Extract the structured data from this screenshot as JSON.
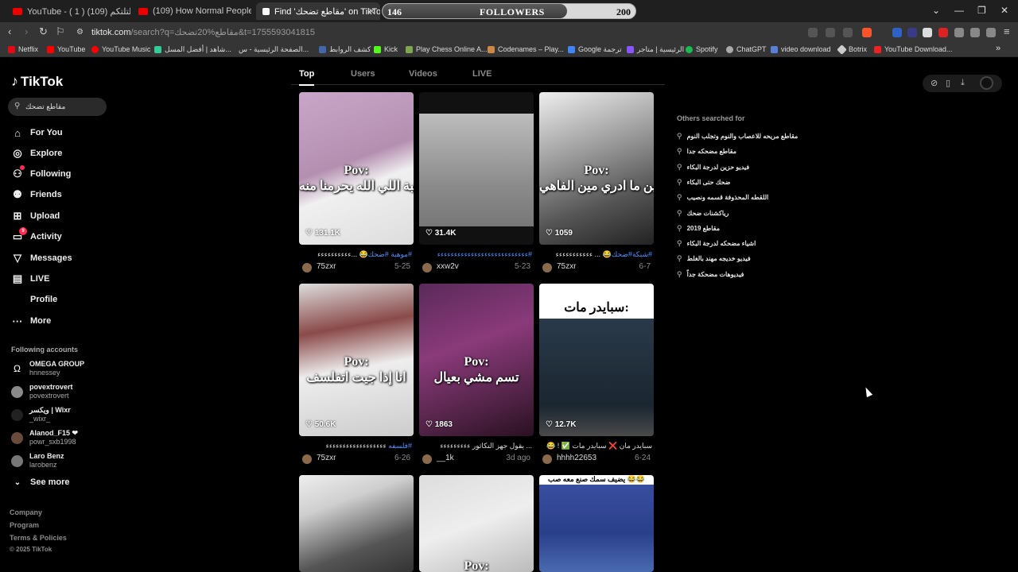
{
  "browser": {
    "tabs": [
      {
        "title": "YouTube - ( 1 ) اسلتلتكم (109)"
      },
      {
        "title": "(109) How Normal People Use C"
      },
      {
        "title": "Find 'مقاطع تضحك' on TikTok"
      }
    ],
    "followers_widget": {
      "current": "146",
      "label": "FOLLOWERS",
      "goal": "200",
      "progress": 0.73
    },
    "url_host": "tiktok.com",
    "url_rest": "/search?q=مقاطع%20تضحك&t=1755593041815",
    "bookmarks": [
      "Netflix",
      "YouTube",
      "YouTube Music",
      "شاهد | أفضل المسل...",
      "الصفحة الرئيسية - س...",
      "كشف الروابط",
      "Kick",
      "Play Chess Online A...",
      "Codenames – Play...",
      "Google ترجمة",
      "الرئيسية | متاجر",
      "Spotify",
      "ChatGPT",
      "video download",
      "Botrix",
      "YouTube Download..."
    ]
  },
  "sidebar": {
    "logo": "TikTok",
    "search_value": "مقاطع تضحك",
    "nav": [
      {
        "label": "For You",
        "icon": "home-icon"
      },
      {
        "label": "Explore",
        "icon": "compass-icon"
      },
      {
        "label": "Following",
        "icon": "following-icon"
      },
      {
        "label": "Friends",
        "icon": "friends-icon"
      },
      {
        "label": "Upload",
        "icon": "upload-icon"
      },
      {
        "label": "Activity",
        "icon": "activity-icon",
        "badge": "9"
      },
      {
        "label": "Messages",
        "icon": "messages-icon"
      },
      {
        "label": "LIVE",
        "icon": "live-icon"
      },
      {
        "label": "Profile",
        "icon": "profile-icon"
      },
      {
        "label": "More",
        "icon": "more-icon"
      }
    ],
    "following_title": "Following accounts",
    "accounts": [
      {
        "name": "OMEGA GROUP",
        "handle": "hnnessey"
      },
      {
        "name": "povextrovert",
        "handle": "povextrovert"
      },
      {
        "name": "ويكسر | Wixr",
        "handle": "_wixr_"
      },
      {
        "name": "Alanod_F15 ❤",
        "handle": "powr_sxb1998"
      },
      {
        "name": "Laro Benz",
        "handle": "larobenz"
      }
    ],
    "see_more": "See more",
    "footer": [
      "Company",
      "Program",
      "Terms & Policies",
      "© 2025 TikTok"
    ]
  },
  "search_tabs": [
    "Top",
    "Users",
    "Videos",
    "LIVE"
  ],
  "videos": [
    {
      "overlay": "Pov:\nوهبة اللي الله يحرمنا منه",
      "likes": "131.1K",
      "caption": "#موهبة #ضحك😂 ...ءءءءءءءءءء",
      "owner": "75zxr",
      "date": "5-25"
    },
    {
      "overlay": "",
      "likes": "31.4K",
      "caption": "#ءءءءءءءءءءءءءءءءءءءءءءءءءءء",
      "owner": "xxw2v",
      "date": "5-23"
    },
    {
      "overlay": "Pov:\nللحين ما ادري مين الفاهي",
      "likes": "1059",
      "caption": "#شبكة#ضحك😂 ... ءءءءءءءءءءء",
      "owner": "75zxr",
      "date": "6-7"
    },
    {
      "overlay": "Pov:\nانا إذا جيت اتفلسف",
      "likes": "50.6K",
      "caption": "#فلسفه ءءءءءءءءءءءءءءءءءء",
      "owner": "75zxr",
      "date": "6-26"
    },
    {
      "overlay": "Pov:\nتسم مشي بعيال",
      "likes": "1863",
      "caption": "... يقول جهز التكاثور ءءءءءءءءء",
      "owner": "__1k",
      "date": "3d ago"
    },
    {
      "overlay": "سبايدر مات:",
      "likes": "12.7K",
      "caption": "سبايدر مان ❌ سبايدر مات ✅ ! 😂",
      "owner": "hhhh22653",
      "date": "6-24"
    },
    {
      "overlay": "",
      "likes": "",
      "caption": "",
      "owner": "",
      "date": ""
    },
    {
      "overlay": "Pov:",
      "likes": "",
      "caption": "",
      "owner": "",
      "date": ""
    },
    {
      "overlay": "يضيف سمك صنع معه صب 😂😂",
      "likes": "",
      "caption": "",
      "owner": "",
      "date": ""
    }
  ],
  "others": {
    "title": "Others searched for",
    "items": [
      "مقاطع مريحه للاعصاب والنوم وتجلب النوم",
      "مقاطع مضحكه جدا",
      "فيديو حزين لدرجة البكاء",
      "ضحك حتى البكاء",
      "اللقطه المحذوفة قسمه ونصيب",
      "رياكشنات ضحك",
      "مقاطع 2019",
      "اشياء مضحكه لدرجة البكاء",
      "فيديو خديجه مهند بالغلط",
      "فيديوهات مضحكة جداً"
    ]
  },
  "colors": {
    "accent": "#fe2c55",
    "hashtag": "#4a90ff",
    "bg": "#000000"
  }
}
